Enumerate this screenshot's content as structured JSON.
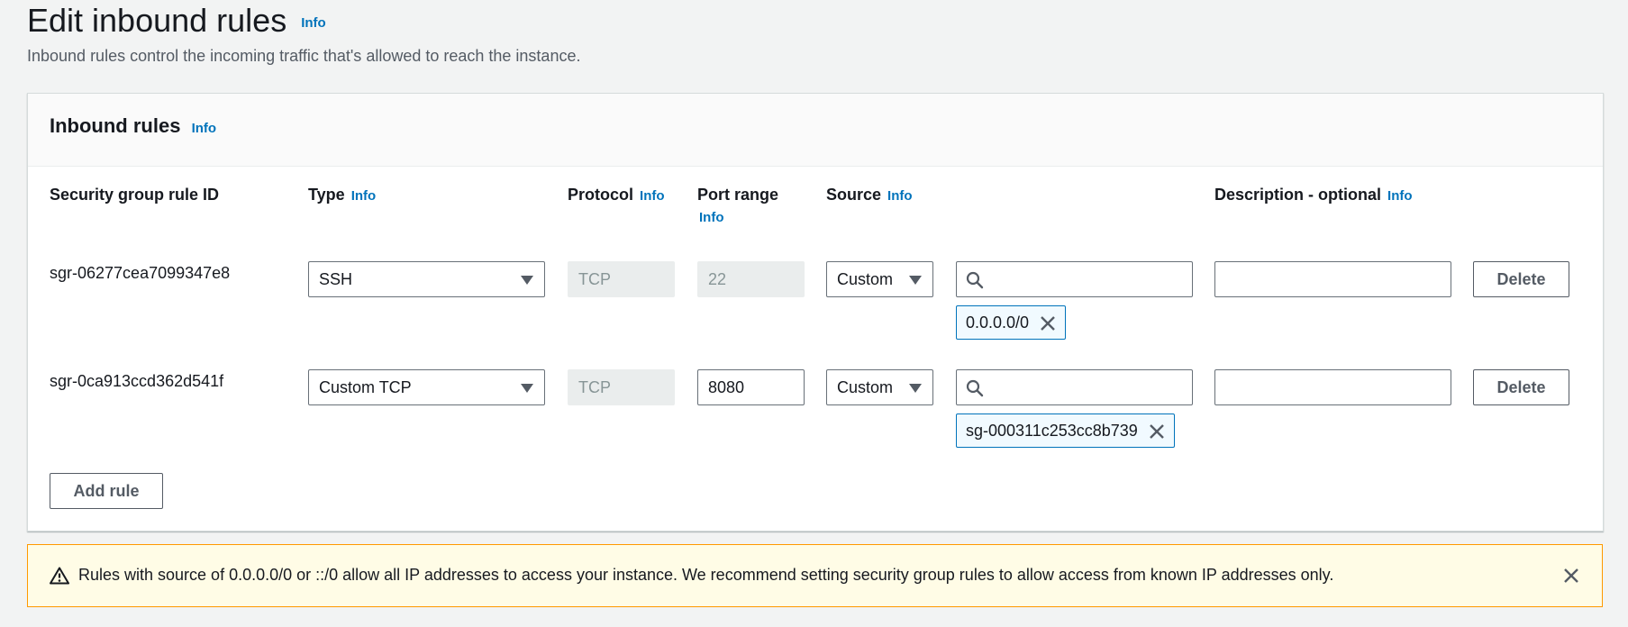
{
  "header": {
    "title": "Edit inbound rules",
    "info": "Info",
    "description": "Inbound rules control the incoming traffic that's allowed to reach the instance."
  },
  "panel": {
    "title": "Inbound rules",
    "info": "Info",
    "columns": {
      "rule_id": "Security group rule ID",
      "type": "Type",
      "type_info": "Info",
      "protocol": "Protocol",
      "protocol_info": "Info",
      "port_range": "Port range",
      "port_range_info": "Info",
      "source": "Source",
      "source_info": "Info",
      "description": "Description - optional",
      "description_info": "Info"
    },
    "rules": [
      {
        "id": "sgr-06277cea7099347e8",
        "type": "SSH",
        "protocol": "TCP",
        "port_range": "22",
        "source_mode": "Custom",
        "source_search": "",
        "source_token": "0.0.0.0/0",
        "description": "",
        "delete_label": "Delete"
      },
      {
        "id": "sgr-0ca913ccd362d541f",
        "type": "Custom TCP",
        "protocol": "TCP",
        "port_range": "8080",
        "source_mode": "Custom",
        "source_search": "",
        "source_token": "sg-000311c253cc8b739",
        "description": "",
        "delete_label": "Delete"
      }
    ],
    "add_rule_label": "Add rule"
  },
  "warning": {
    "text": "Rules with source of 0.0.0.0/0 or ::/0 allow all IP addresses to access your instance. We recommend setting security group rules to allow access from known IP addresses only."
  },
  "icons": {
    "search": "search-icon",
    "close": "close-icon",
    "warning": "warning-icon",
    "caret": "caret-down-icon"
  },
  "colors": {
    "link": "#0073bb",
    "warning_border": "#ff9900",
    "warning_bg": "#fffce6"
  }
}
